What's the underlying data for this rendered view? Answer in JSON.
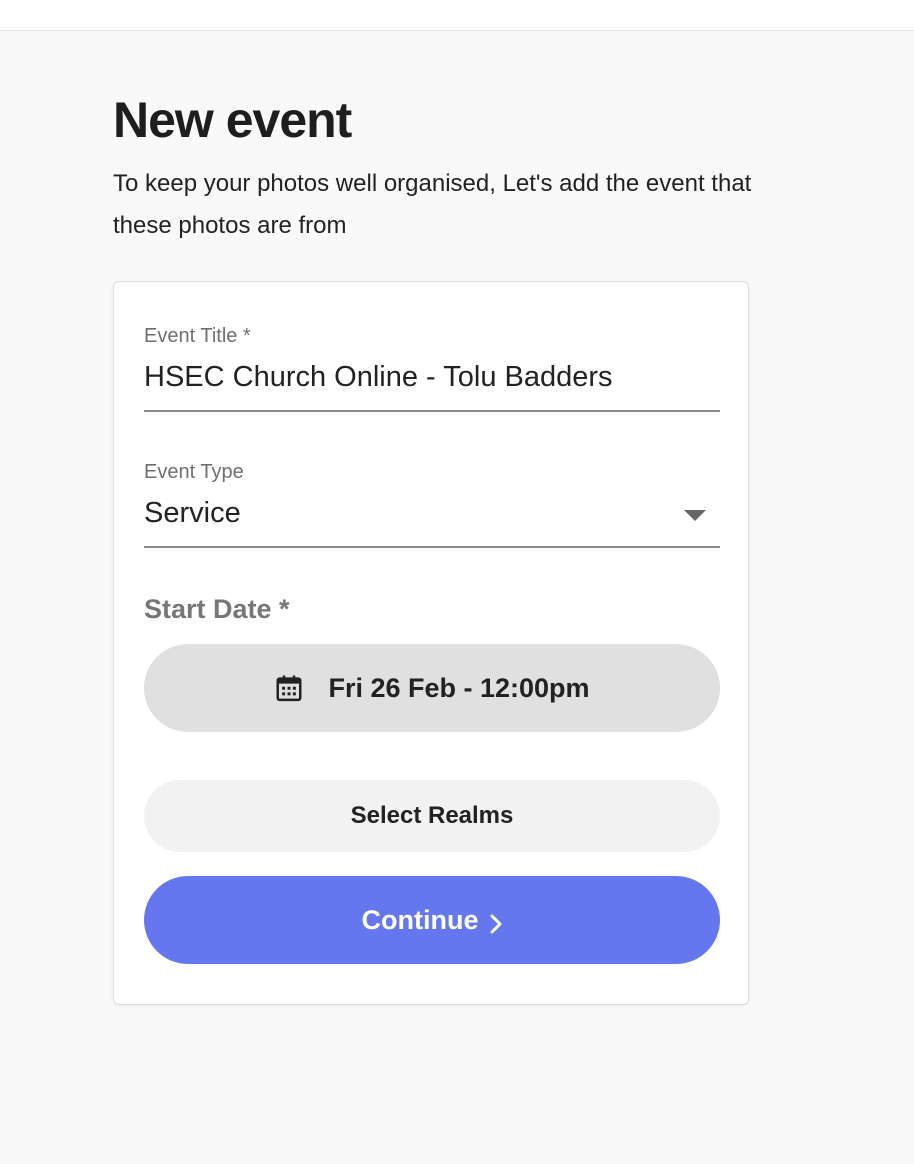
{
  "page": {
    "title": "New event",
    "subtitle": "To keep your photos well organised, Let's add the event that these photos are from"
  },
  "form": {
    "event_title": {
      "label": "Event Title *",
      "value": "HSEC Church Online - Tolu Badders"
    },
    "event_type": {
      "label": "Event Type",
      "value": "Service",
      "icon": "chevron-down-icon"
    },
    "start_date": {
      "label": "Start Date *",
      "value": "Fri 26 Feb - 12:00pm",
      "icon": "calendar-icon"
    },
    "select_realms_label": "Select Realms",
    "continue_label": "Continue",
    "continue_icon": "chevron-right-icon"
  },
  "colors": {
    "accent": "#6577ef",
    "background": "#f9f9f9",
    "card": "#ffffff",
    "date_button": "#e0e0e0",
    "secondary_button": "#f2f2f2"
  }
}
